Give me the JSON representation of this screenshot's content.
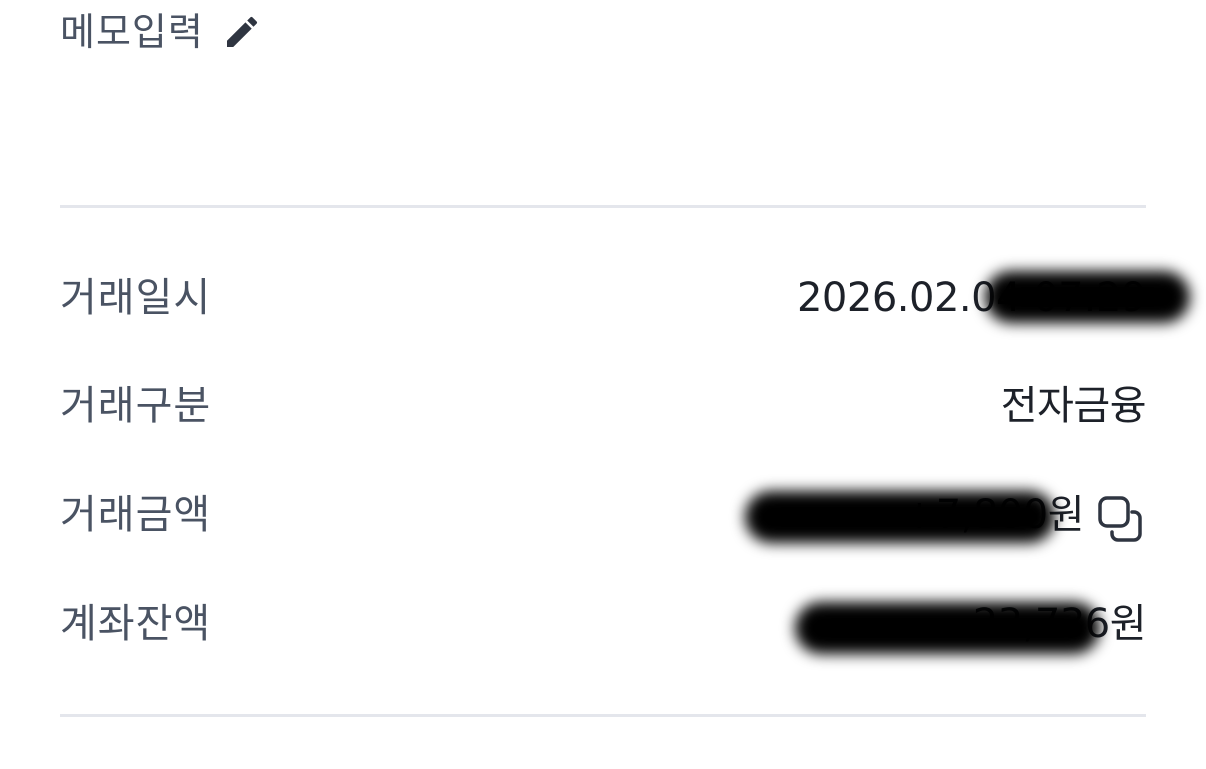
{
  "memo": {
    "label": "메모입력",
    "icon": "pencil-icon"
  },
  "details": [
    {
      "label": "거래일시",
      "value": "2026.02.04 07:29"
    },
    {
      "label": "거래구분",
      "value": "전자금융"
    },
    {
      "label": "거래금액",
      "value": "+7,800원",
      "icon": "copy-icon"
    },
    {
      "label": "계좌잔액",
      "value": "23,736원"
    }
  ],
  "colors": {
    "label": "#4a5363",
    "value": "#1d2129",
    "divider": "#e4e6ec"
  }
}
